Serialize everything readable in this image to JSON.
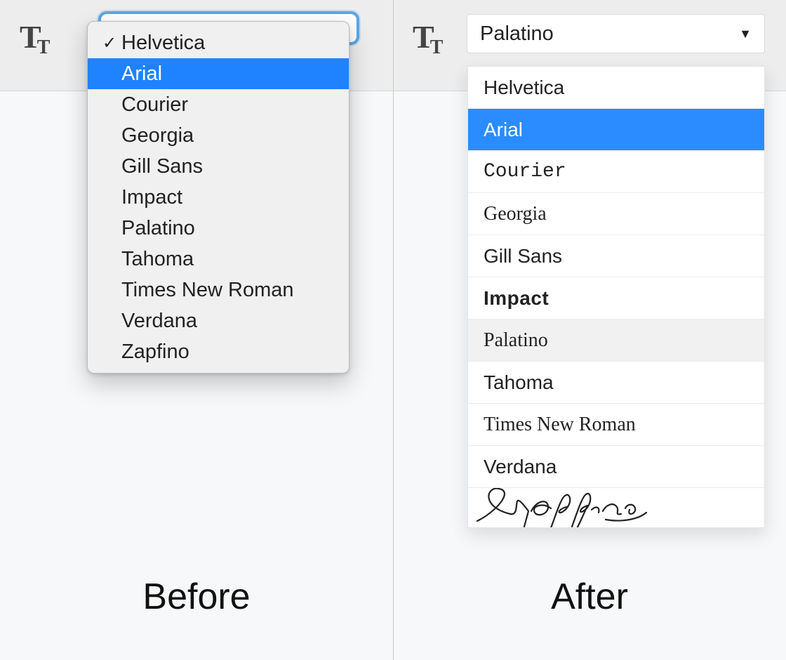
{
  "captions": {
    "before": "Before",
    "after": "After"
  },
  "icon_glyph": {
    "big": "T",
    "small": "T"
  },
  "before": {
    "selected": "Helvetica",
    "highlighted": "Arial",
    "items": [
      "Helvetica",
      "Arial",
      "Courier",
      "Georgia",
      "Gill Sans",
      "Impact",
      "Palatino",
      "Tahoma",
      "Times New Roman",
      "Verdana",
      "Zapfino"
    ]
  },
  "after": {
    "selected": "Palatino",
    "highlighted": "Arial",
    "hovered": "Palatino",
    "items": [
      {
        "name": "Helvetica",
        "font_class": "ff-helvetica"
      },
      {
        "name": "Arial",
        "font_class": "ff-arial"
      },
      {
        "name": "Courier",
        "font_class": "ff-courier"
      },
      {
        "name": "Georgia",
        "font_class": "ff-georgia"
      },
      {
        "name": "Gill Sans",
        "font_class": "ff-gillsans"
      },
      {
        "name": "Impact",
        "font_class": "ff-impact"
      },
      {
        "name": "Palatino",
        "font_class": "ff-palatino"
      },
      {
        "name": "Tahoma",
        "font_class": "ff-tahoma"
      },
      {
        "name": "Times New Roman",
        "font_class": "ff-times"
      },
      {
        "name": "Verdana",
        "font_class": "ff-verdana"
      },
      {
        "name": "Zapfino",
        "font_class": "ff-zapfino"
      }
    ]
  }
}
